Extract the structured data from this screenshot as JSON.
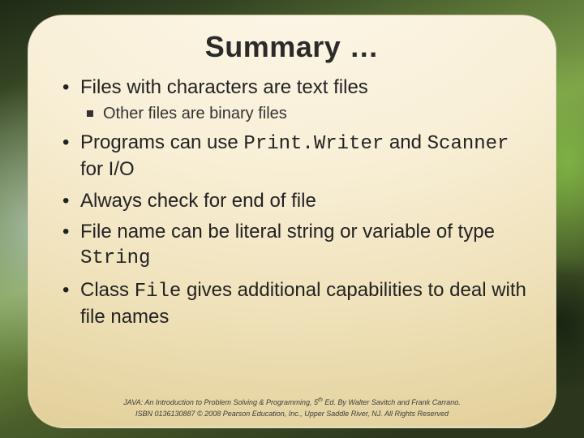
{
  "title": "Summary …",
  "bullets": {
    "b1": "Files with characters are text files",
    "b1a": "Other files are binary files",
    "b2_pre": "Programs can use ",
    "b2_code1": "Print.Writer",
    "b2_mid": " and ",
    "b2_code2": "Scanner",
    "b2_post": " for I/O",
    "b3": "Always check for end of file",
    "b4_pre": "File name can be literal string or variable of type ",
    "b4_code": "String",
    "b5_pre": "Class ",
    "b5_code": "File",
    "b5_post": " gives additional capabilities to deal with file names"
  },
  "footer": {
    "line1_a": "JAVA: An Introduction to Problem Solving & Programming, 5",
    "line1_sup": "th",
    "line1_b": " Ed. By Walter Savitch and Frank Carrano.",
    "line2": "ISBN 0136130887 © 2008 Pearson Education, Inc., Upper Saddle River, NJ. All Rights Reserved"
  }
}
